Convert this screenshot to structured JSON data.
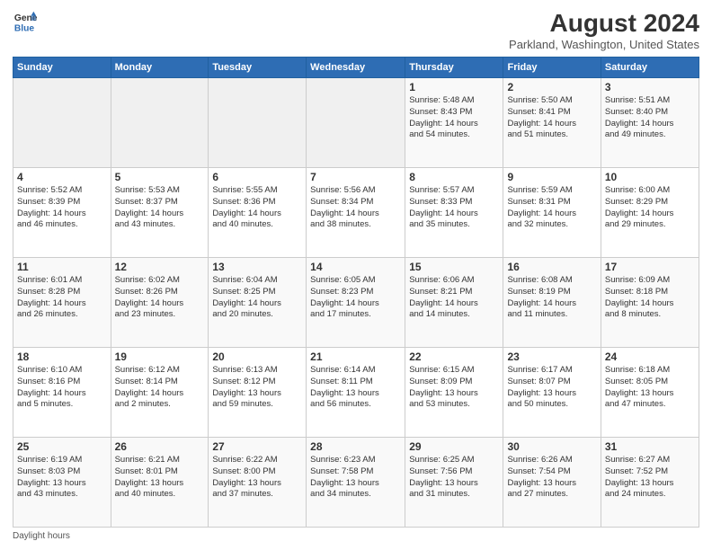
{
  "header": {
    "logo_line1": "General",
    "logo_line2": "Blue",
    "title": "August 2024",
    "subtitle": "Parkland, Washington, United States"
  },
  "days_of_week": [
    "Sunday",
    "Monday",
    "Tuesday",
    "Wednesday",
    "Thursday",
    "Friday",
    "Saturday"
  ],
  "weeks": [
    {
      "days": [
        {
          "num": "",
          "info": ""
        },
        {
          "num": "",
          "info": ""
        },
        {
          "num": "",
          "info": ""
        },
        {
          "num": "",
          "info": ""
        },
        {
          "num": "1",
          "info": "Sunrise: 5:48 AM\nSunset: 8:43 PM\nDaylight: 14 hours\nand 54 minutes."
        },
        {
          "num": "2",
          "info": "Sunrise: 5:50 AM\nSunset: 8:41 PM\nDaylight: 14 hours\nand 51 minutes."
        },
        {
          "num": "3",
          "info": "Sunrise: 5:51 AM\nSunset: 8:40 PM\nDaylight: 14 hours\nand 49 minutes."
        }
      ]
    },
    {
      "days": [
        {
          "num": "4",
          "info": "Sunrise: 5:52 AM\nSunset: 8:39 PM\nDaylight: 14 hours\nand 46 minutes."
        },
        {
          "num": "5",
          "info": "Sunrise: 5:53 AM\nSunset: 8:37 PM\nDaylight: 14 hours\nand 43 minutes."
        },
        {
          "num": "6",
          "info": "Sunrise: 5:55 AM\nSunset: 8:36 PM\nDaylight: 14 hours\nand 40 minutes."
        },
        {
          "num": "7",
          "info": "Sunrise: 5:56 AM\nSunset: 8:34 PM\nDaylight: 14 hours\nand 38 minutes."
        },
        {
          "num": "8",
          "info": "Sunrise: 5:57 AM\nSunset: 8:33 PM\nDaylight: 14 hours\nand 35 minutes."
        },
        {
          "num": "9",
          "info": "Sunrise: 5:59 AM\nSunset: 8:31 PM\nDaylight: 14 hours\nand 32 minutes."
        },
        {
          "num": "10",
          "info": "Sunrise: 6:00 AM\nSunset: 8:29 PM\nDaylight: 14 hours\nand 29 minutes."
        }
      ]
    },
    {
      "days": [
        {
          "num": "11",
          "info": "Sunrise: 6:01 AM\nSunset: 8:28 PM\nDaylight: 14 hours\nand 26 minutes."
        },
        {
          "num": "12",
          "info": "Sunrise: 6:02 AM\nSunset: 8:26 PM\nDaylight: 14 hours\nand 23 minutes."
        },
        {
          "num": "13",
          "info": "Sunrise: 6:04 AM\nSunset: 8:25 PM\nDaylight: 14 hours\nand 20 minutes."
        },
        {
          "num": "14",
          "info": "Sunrise: 6:05 AM\nSunset: 8:23 PM\nDaylight: 14 hours\nand 17 minutes."
        },
        {
          "num": "15",
          "info": "Sunrise: 6:06 AM\nSunset: 8:21 PM\nDaylight: 14 hours\nand 14 minutes."
        },
        {
          "num": "16",
          "info": "Sunrise: 6:08 AM\nSunset: 8:19 PM\nDaylight: 14 hours\nand 11 minutes."
        },
        {
          "num": "17",
          "info": "Sunrise: 6:09 AM\nSunset: 8:18 PM\nDaylight: 14 hours\nand 8 minutes."
        }
      ]
    },
    {
      "days": [
        {
          "num": "18",
          "info": "Sunrise: 6:10 AM\nSunset: 8:16 PM\nDaylight: 14 hours\nand 5 minutes."
        },
        {
          "num": "19",
          "info": "Sunrise: 6:12 AM\nSunset: 8:14 PM\nDaylight: 14 hours\nand 2 minutes."
        },
        {
          "num": "20",
          "info": "Sunrise: 6:13 AM\nSunset: 8:12 PM\nDaylight: 13 hours\nand 59 minutes."
        },
        {
          "num": "21",
          "info": "Sunrise: 6:14 AM\nSunset: 8:11 PM\nDaylight: 13 hours\nand 56 minutes."
        },
        {
          "num": "22",
          "info": "Sunrise: 6:15 AM\nSunset: 8:09 PM\nDaylight: 13 hours\nand 53 minutes."
        },
        {
          "num": "23",
          "info": "Sunrise: 6:17 AM\nSunset: 8:07 PM\nDaylight: 13 hours\nand 50 minutes."
        },
        {
          "num": "24",
          "info": "Sunrise: 6:18 AM\nSunset: 8:05 PM\nDaylight: 13 hours\nand 47 minutes."
        }
      ]
    },
    {
      "days": [
        {
          "num": "25",
          "info": "Sunrise: 6:19 AM\nSunset: 8:03 PM\nDaylight: 13 hours\nand 43 minutes."
        },
        {
          "num": "26",
          "info": "Sunrise: 6:21 AM\nSunset: 8:01 PM\nDaylight: 13 hours\nand 40 minutes."
        },
        {
          "num": "27",
          "info": "Sunrise: 6:22 AM\nSunset: 8:00 PM\nDaylight: 13 hours\nand 37 minutes."
        },
        {
          "num": "28",
          "info": "Sunrise: 6:23 AM\nSunset: 7:58 PM\nDaylight: 13 hours\nand 34 minutes."
        },
        {
          "num": "29",
          "info": "Sunrise: 6:25 AM\nSunset: 7:56 PM\nDaylight: 13 hours\nand 31 minutes."
        },
        {
          "num": "30",
          "info": "Sunrise: 6:26 AM\nSunset: 7:54 PM\nDaylight: 13 hours\nand 27 minutes."
        },
        {
          "num": "31",
          "info": "Sunrise: 6:27 AM\nSunset: 7:52 PM\nDaylight: 13 hours\nand 24 minutes."
        }
      ]
    }
  ],
  "footer": "Daylight hours"
}
